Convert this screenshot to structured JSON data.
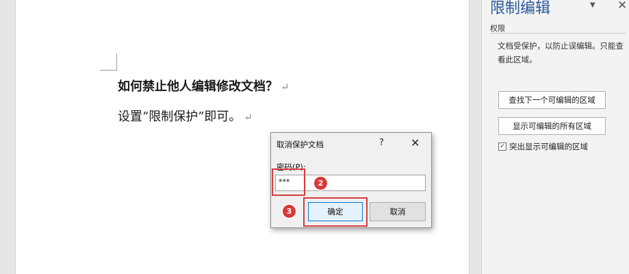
{
  "document": {
    "line1": "如何禁止他人编辑修改文档？",
    "line2": "设置“限制保护”即可。",
    "paragraph_mark": "↵"
  },
  "pane": {
    "title": "限制编辑",
    "dropdown_icon": "▼",
    "close_icon": "✕",
    "section_label": "权限",
    "description": "文档受保护，以防止误编辑。只能查看此区域。",
    "find_next_button": "查找下一个可编辑的区域",
    "show_all_button": "显示可编辑的所有区域",
    "highlight_checkbox": {
      "label": "突出显示可编辑的区域",
      "checked": true,
      "mark": "✓"
    }
  },
  "dialog": {
    "title": "取消保护文档",
    "help_icon": "?",
    "close_icon": "✕",
    "password_label": "密码(P):",
    "password_value": "***",
    "ok_button": "确定",
    "cancel_button": "取消"
  },
  "annotations": {
    "step2": "2",
    "step3": "3",
    "highlight_color": "#d63a3a"
  }
}
